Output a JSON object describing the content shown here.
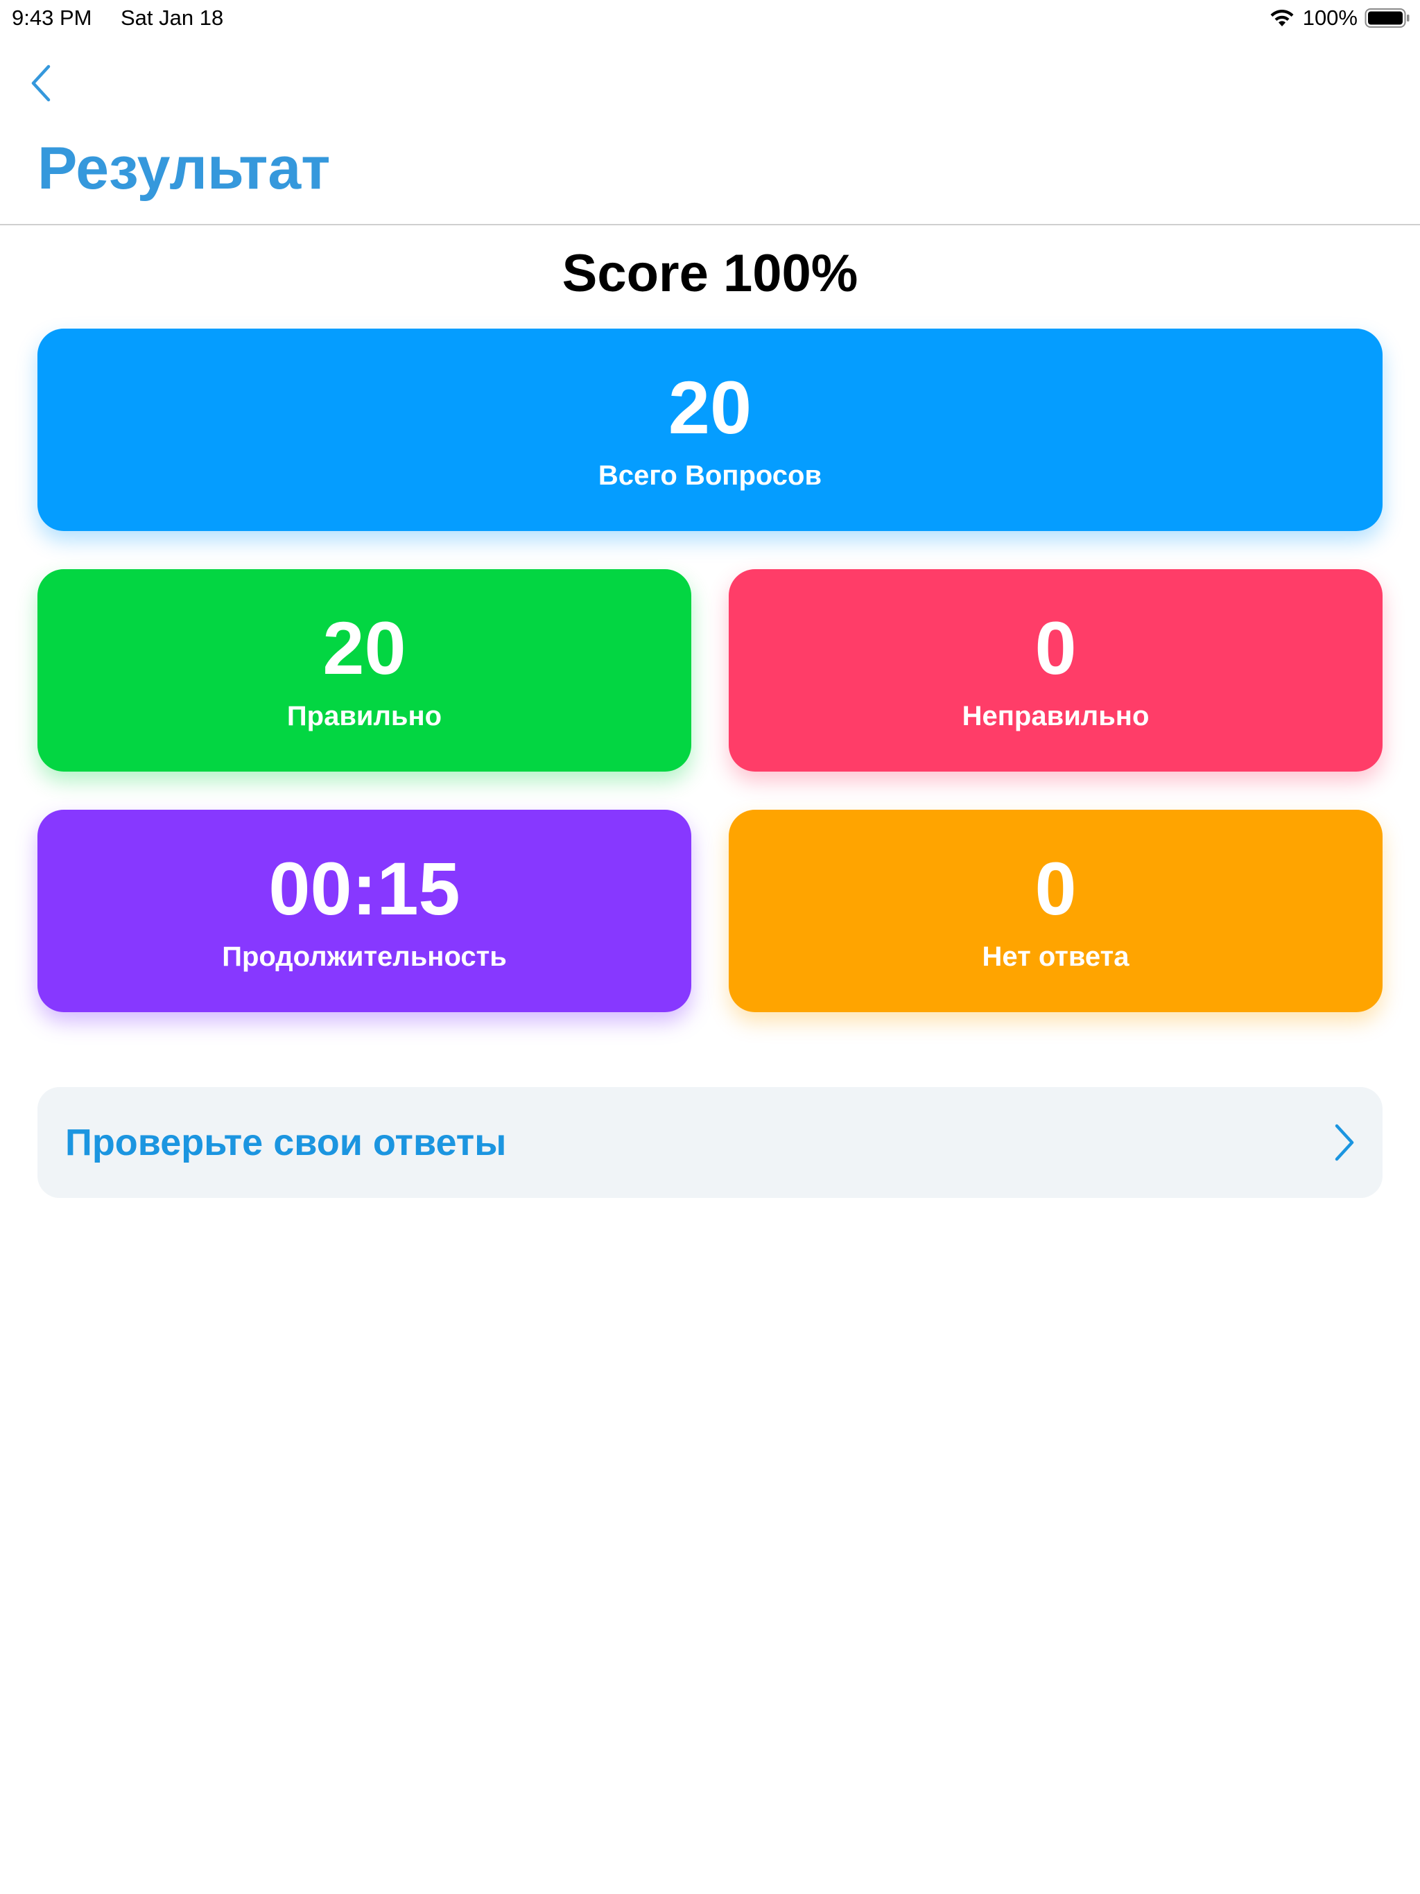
{
  "status_bar": {
    "time": "9:43 PM",
    "date": "Sat Jan 18",
    "battery_text": "100%",
    "battery_level": 1.0
  },
  "nav": {
    "back_icon": "chevron-left-icon",
    "title": "Результат"
  },
  "score": {
    "title": "Score 100%"
  },
  "cards": {
    "total": {
      "value": "20",
      "label": "Всего Вопросов",
      "color": "#059dff"
    },
    "correct": {
      "value": "20",
      "label": "Правильно",
      "color": "#03d642"
    },
    "wrong": {
      "value": "0",
      "label": "Неправильно",
      "color": "#ff3d68"
    },
    "duration": {
      "value": "00:15",
      "label": "Продолжительность",
      "color": "#8738ff"
    },
    "no_answer": {
      "value": "0",
      "label": "Нет ответа",
      "color": "#ffa400"
    }
  },
  "review": {
    "label": "Проверьте свои ответы",
    "icon": "chevron-right-icon"
  },
  "colors": {
    "accent": "#3598dc",
    "link": "#1b95e0",
    "row_background": "#f0f4f7"
  }
}
